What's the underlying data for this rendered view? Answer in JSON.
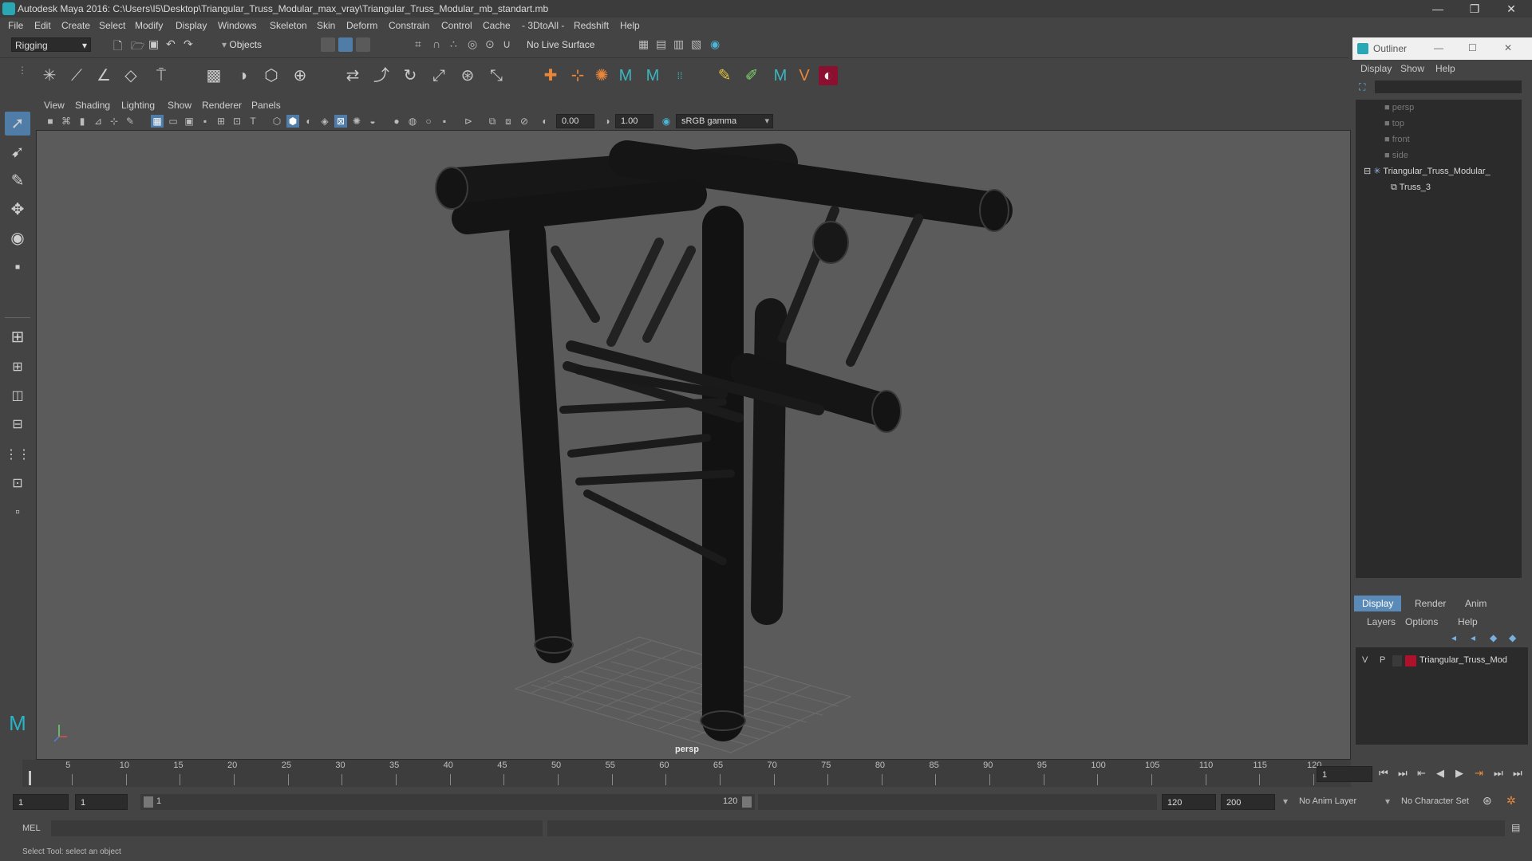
{
  "window": {
    "title": "Autodesk Maya 2016: C:\\Users\\I5\\Desktop\\Triangular_Truss_Modular_max_vray\\Triangular_Truss_Modular_mb_standart.mb",
    "minimize": "—",
    "restore": "❐",
    "close": "✕"
  },
  "menubar": [
    "File",
    "Edit",
    "Create",
    "Select",
    "Modify",
    "Display",
    "Windows",
    "Skeleton",
    "Skin",
    "Deform",
    "Constrain",
    "Control",
    "Cache",
    "- 3DtoAll -",
    "Redshift",
    "Help"
  ],
  "statusline": {
    "menuset": "Rigging",
    "selection_mode": "Objects",
    "live_surface": "No Live Surface"
  },
  "viewport": {
    "menu": [
      "View",
      "Shading",
      "Lighting",
      "Show",
      "Renderer",
      "Panels"
    ],
    "exposure": "0.00",
    "gamma": "1.00",
    "color_space": "sRGB gamma",
    "camera_label": "persp"
  },
  "outliner": {
    "title": "Outliner",
    "menu": [
      "Display",
      "Show",
      "Help"
    ],
    "items": [
      {
        "label": "persp",
        "type": "camera",
        "indent": 0
      },
      {
        "label": "top",
        "type": "camera",
        "indent": 0
      },
      {
        "label": "front",
        "type": "camera",
        "indent": 0
      },
      {
        "label": "side",
        "type": "camera",
        "indent": 0
      },
      {
        "label": "Triangular_Truss_Modular_",
        "type": "group",
        "indent": 0
      },
      {
        "label": "Truss_3",
        "type": "mesh",
        "indent": 1
      }
    ]
  },
  "layer_editor": {
    "tabs": [
      "Display",
      "Render",
      "Anim"
    ],
    "menu": [
      "Layers",
      "Options",
      "Help"
    ],
    "layer": {
      "v": "V",
      "p": "P",
      "name": "Triangular_Truss_Mod",
      "color": "#b0112a"
    }
  },
  "timeslider": {
    "ticks": [
      1,
      5,
      10,
      15,
      20,
      25,
      30,
      35,
      40,
      45,
      50,
      55,
      60,
      65,
      70,
      75,
      80,
      85,
      90,
      95,
      100,
      105,
      110,
      115,
      120
    ],
    "current_frame": "1"
  },
  "range": {
    "start": "1",
    "playback_start": "1",
    "slider_start": "1",
    "slider_end": "120",
    "playback_end": "120",
    "end": "200",
    "anim_layer": "No Anim Layer",
    "character_set": "No Character Set"
  },
  "command": {
    "label": "MEL"
  },
  "helpline": "Select Tool: select an object"
}
